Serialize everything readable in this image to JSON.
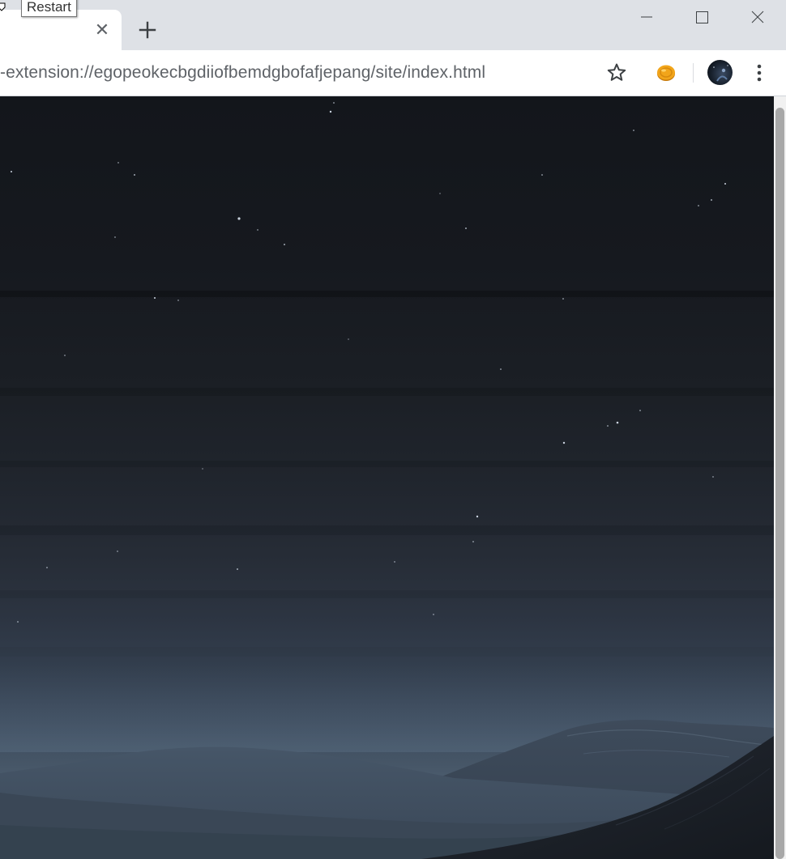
{
  "tooltip": {
    "text": "Restart"
  },
  "tab": {
    "close_glyph": "✕"
  },
  "toolbar": {
    "url": "-extension://egopeokecbgdiiofbemdgbofafjepang/site/index.html",
    "bookmark_icon": "star-outline-icon",
    "extension_icon": "orange-coin-extension-icon",
    "avatar_icon": "profile-avatar-icon",
    "menu_icon": "kebab-menu-icon"
  },
  "window_controls": [
    "minimize",
    "maximize",
    "close"
  ],
  "content": {
    "scene": "night-sky-with-mountains"
  },
  "colors": {
    "tabstrip": "#dee1e6",
    "toolbar": "#ffffff",
    "url_text": "#5f6368",
    "sky_top": "#13161b",
    "sky_horizon": "#4f6073",
    "mountain_far": "#3a4858",
    "mountain_near": "#1a1f27",
    "scroll_thumb": "#a8a8a8"
  }
}
